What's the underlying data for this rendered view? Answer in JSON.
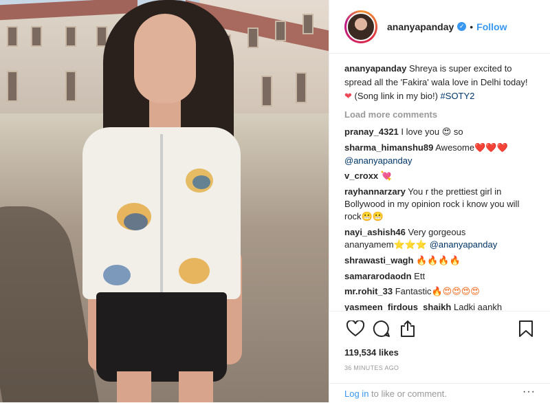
{
  "header": {
    "username": "ananyapanday",
    "verified_icon": "verified-badge",
    "separator": "•",
    "follow_label": "Follow"
  },
  "caption": {
    "username": "ananyapanday",
    "text": "Shreya is super excited to spread all the 'Fakira' wala love in Delhi today!",
    "emoji": "❤️",
    "text_after": "(Song link in my bio!)",
    "hashtag": "#SOTY2"
  },
  "load_more_label": "Load more comments",
  "comments": [
    {
      "user": "pranay_4321",
      "text": "I love you",
      "emoji": "😍",
      "text_after": "so",
      "mention": ""
    },
    {
      "user": "sharma_himanshu89",
      "text": "Awesome",
      "emoji": "❤️❤️❤️",
      "text_after": "",
      "mention": "@ananyapanday"
    },
    {
      "user": "v_croxx",
      "text": "",
      "emoji": "💘",
      "text_after": "",
      "mention": ""
    },
    {
      "user": "rayhannarzary",
      "text": "You r the prettiest girl in Bollywood in my opinion rock i know you will rock",
      "emoji": "😬😬",
      "text_after": "",
      "mention": ""
    },
    {
      "user": "nayi_ashish46",
      "text": "Very gorgeous ananyamem",
      "emoji": "⭐⭐⭐",
      "text_after": "",
      "mention": "@ananyapanday"
    },
    {
      "user": "shrawasti_wagh",
      "text": "",
      "emoji": "🔥🔥🔥🔥",
      "text_after": "",
      "mention": ""
    },
    {
      "user": "samararodaodn",
      "text": "Ett",
      "emoji": "",
      "text_after": "",
      "mention": ""
    },
    {
      "user": "mr.rohit_33",
      "text": "Fantastic",
      "emoji": "🔥😍😍😍😍",
      "text_after": "",
      "mention": ""
    },
    {
      "user": "yasmeen_firdous_shaikh",
      "text": "Ladki aankh",
      "emoji": "",
      "text_after": "",
      "mention": ""
    }
  ],
  "actions": {
    "like_icon": "heart-outline-icon",
    "comment_icon": "comment-bubble-icon",
    "share_icon": "share-icon",
    "save_icon": "bookmark-icon"
  },
  "likes_label": "119,534 likes",
  "timestamp": "36 MINUTES AGO",
  "login_prompt": {
    "link_text": "Log in",
    "rest_text": "to like or comment.",
    "more": "···"
  },
  "colors": {
    "link_blue": "#3897f0",
    "hashtag": "#003569",
    "muted": "#999999",
    "text": "#262626",
    "border": "#efefef"
  }
}
